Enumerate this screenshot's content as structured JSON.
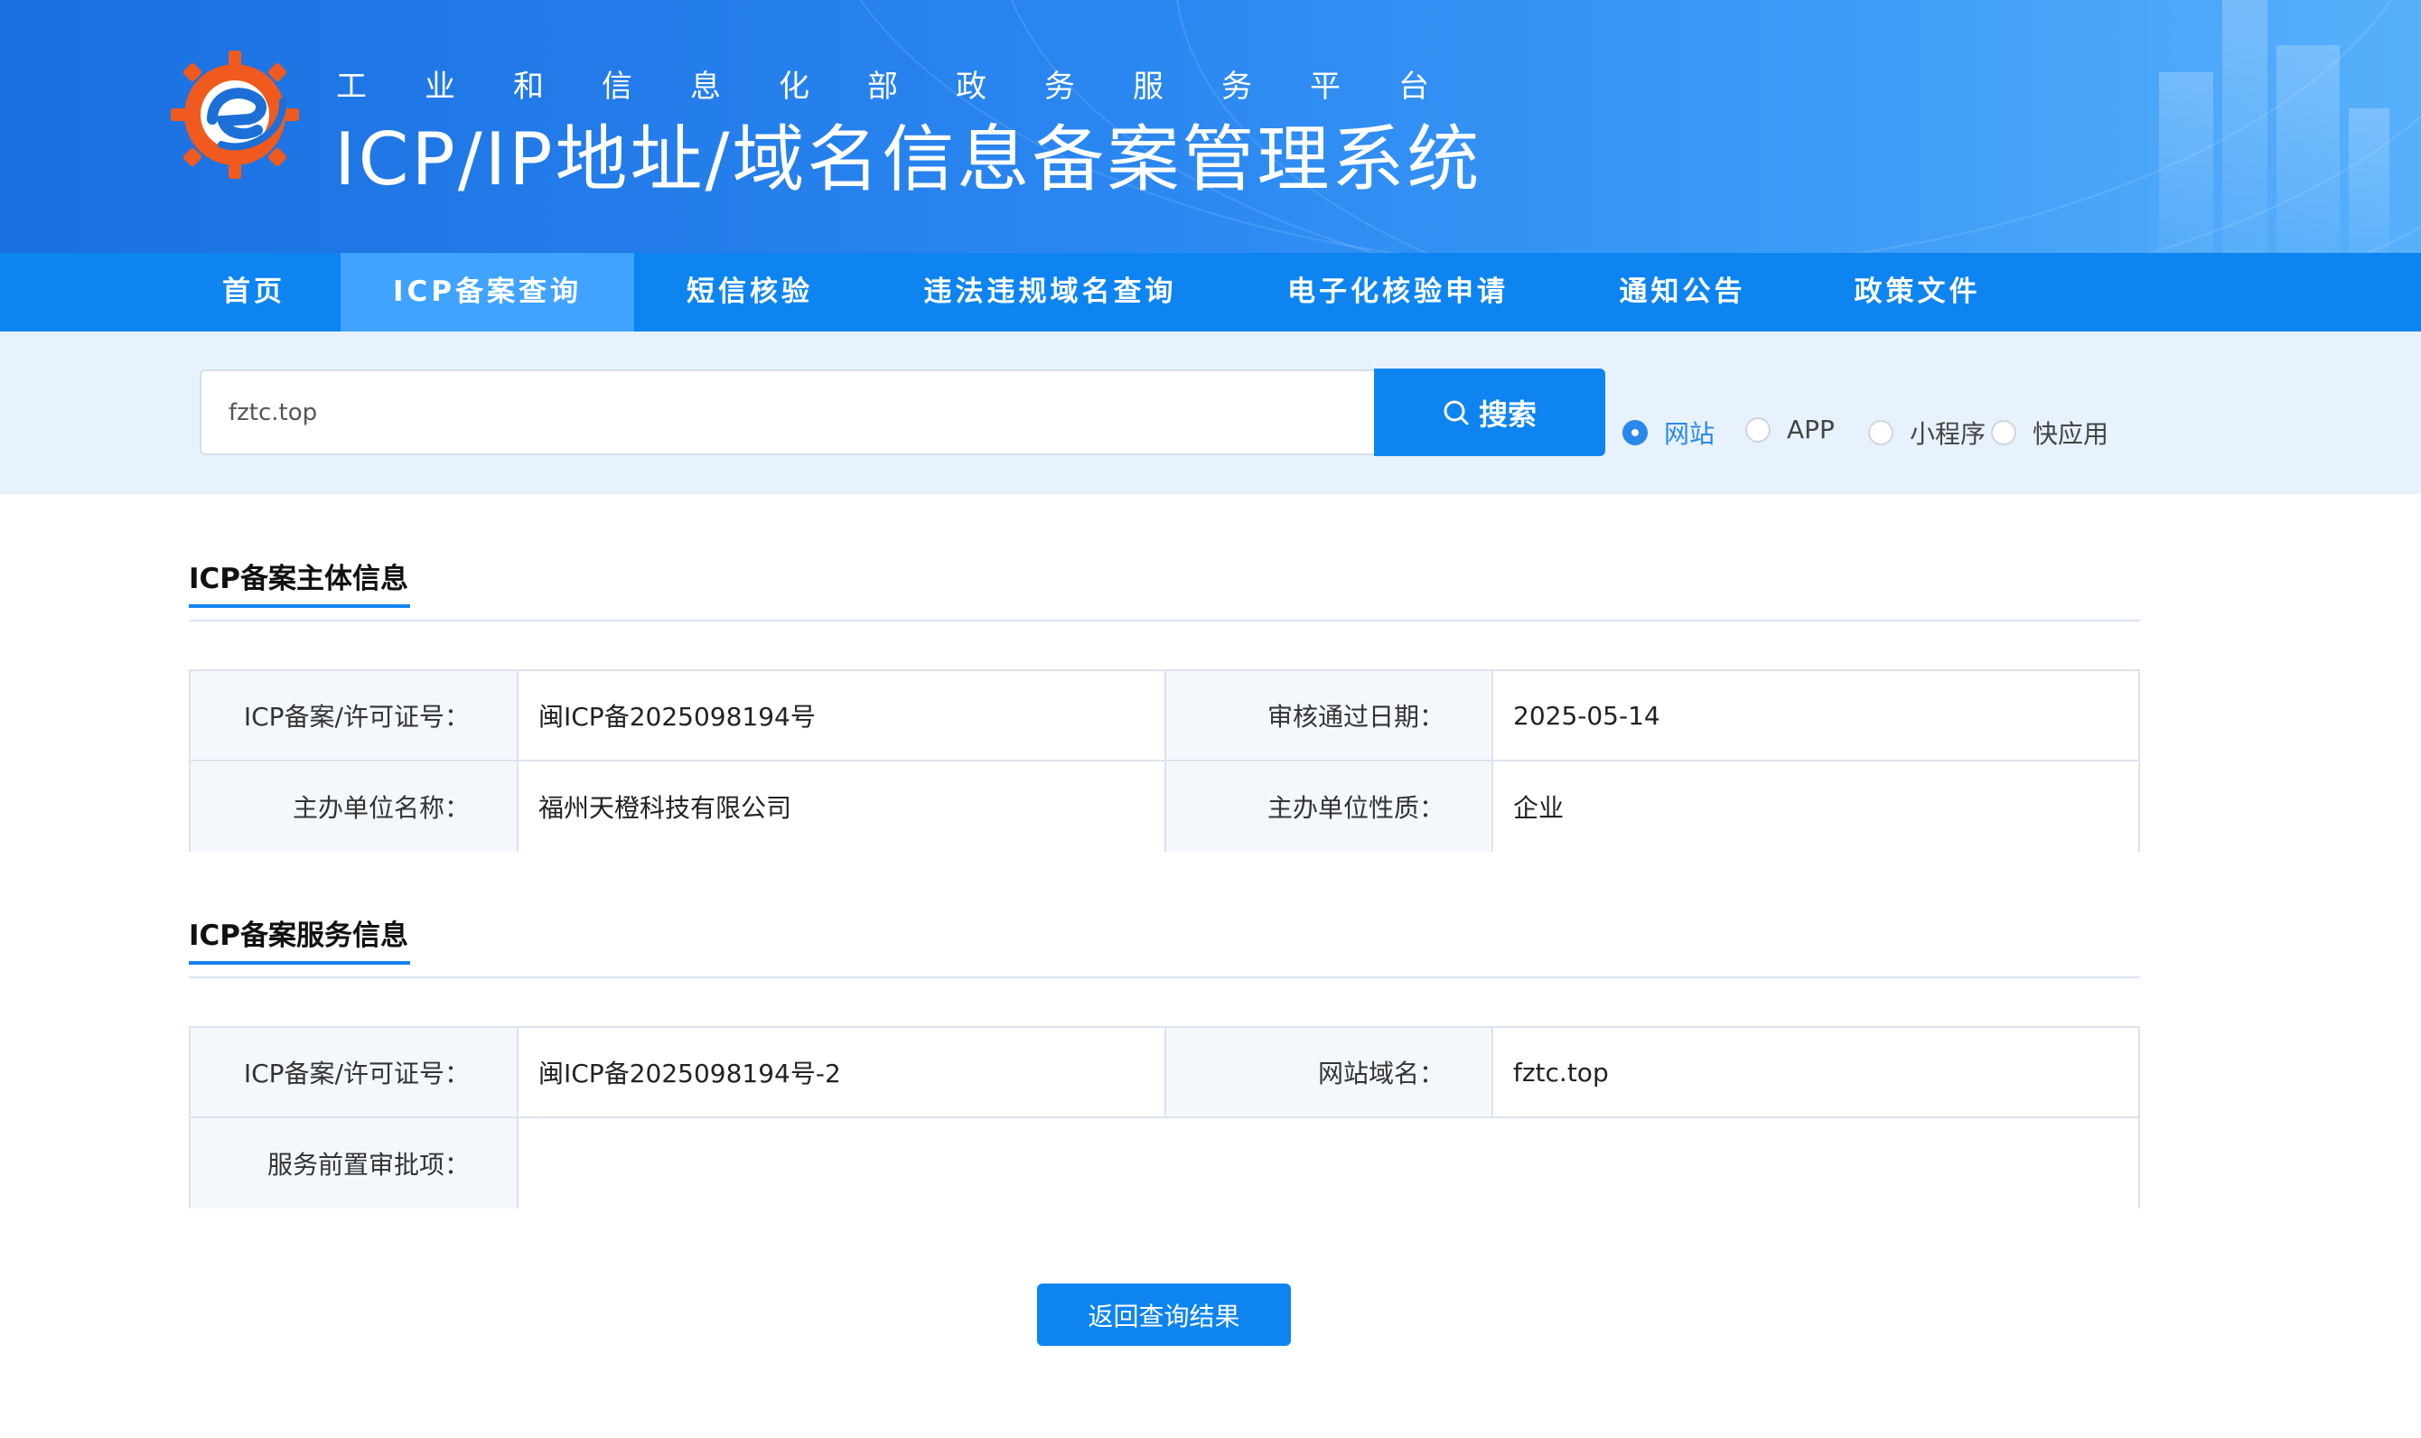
{
  "header": {
    "subtitle": "工业和信息化部政务服务平台",
    "title": "ICP/IP地址/域名信息备案管理系统"
  },
  "nav": {
    "items": [
      {
        "label": "首页",
        "active": false
      },
      {
        "label": "ICP备案查询",
        "active": true
      },
      {
        "label": "短信核验",
        "active": false
      },
      {
        "label": "违法违规域名查询",
        "active": false
      },
      {
        "label": "电子化核验申请",
        "active": false
      },
      {
        "label": "通知公告",
        "active": false
      },
      {
        "label": "政策文件",
        "active": false
      }
    ]
  },
  "search": {
    "value": "fztc.top",
    "button_label": "搜索",
    "types": [
      {
        "label": "网站",
        "selected": true
      },
      {
        "label": "APP",
        "selected": false
      },
      {
        "label": "小程序",
        "selected": false
      },
      {
        "label": "快应用",
        "selected": false
      }
    ]
  },
  "subject_info": {
    "title": "ICP备案主体信息",
    "license_label": "ICP备案/许可证号：",
    "license_value": "闽ICP备2025098194号",
    "approve_date_label": "审核通过日期：",
    "approve_date_value": "2025-05-14",
    "org_name_label": "主办单位名称：",
    "org_name_value": "福州天橙科技有限公司",
    "org_type_label": "主办单位性质：",
    "org_type_value": "企业"
  },
  "service_info": {
    "title": "ICP备案服务信息",
    "license_label": "ICP备案/许可证号：",
    "license_value": "闽ICP备2025098194号-2",
    "domain_label": "网站域名：",
    "domain_value": "fztc.top",
    "pre_approval_label": "服务前置审批项：",
    "pre_approval_value": ""
  },
  "back_button_label": "返回查询结果",
  "colors": {
    "primary": "#0d84f0",
    "nav_active": "#3fa3ff",
    "search_band": "#e7f2fe",
    "label_cell": "#f4f8fd",
    "logo_orange": "#f05a1e"
  }
}
